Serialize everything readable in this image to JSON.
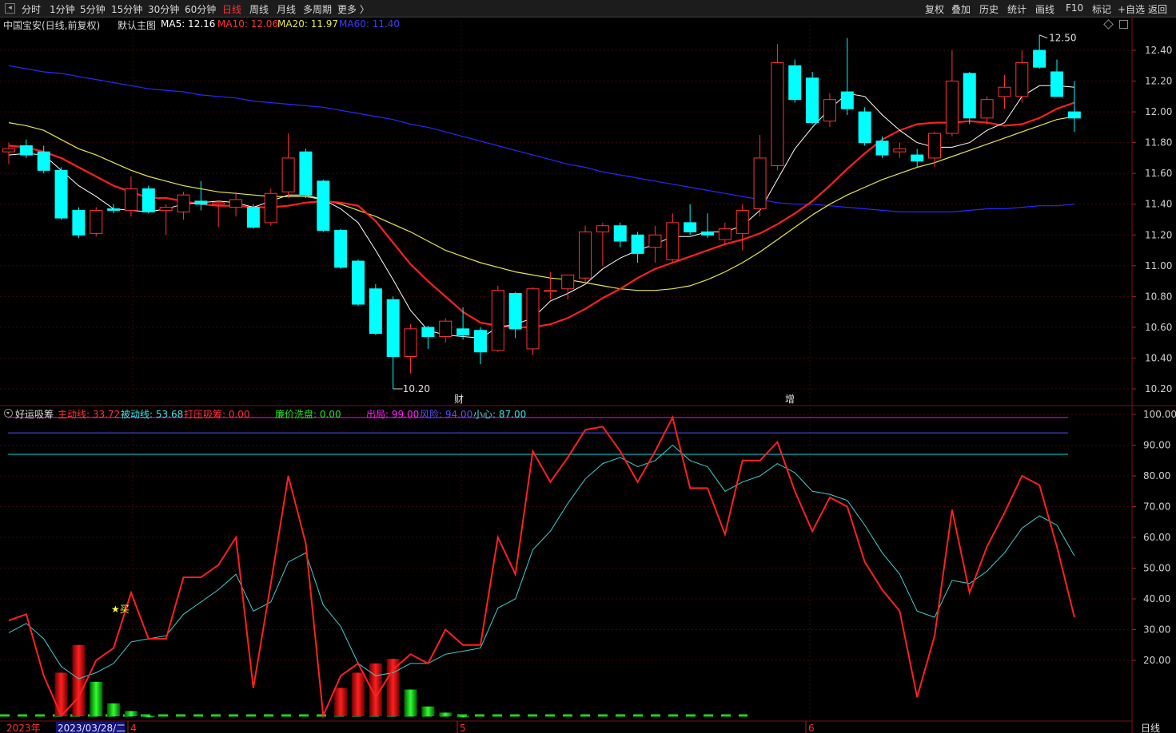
{
  "toolbar": {
    "periods": [
      "分时",
      "1分钟",
      "5分钟",
      "15分钟",
      "30分钟",
      "60分钟",
      "日线",
      "周线",
      "月线",
      "多周期",
      "更多 〉"
    ],
    "active_period": "日线",
    "right": [
      "复权",
      "叠加",
      "历史",
      "统计",
      "画线",
      "F10",
      "标记",
      "+自选",
      "返回"
    ]
  },
  "main_info": {
    "stock": "中国宝安(日线,前复权)",
    "template": "默认主图",
    "ma5": "MA5: 12.16",
    "ma10": "MA10: 12.06",
    "ma20": "MA20: 11.97",
    "ma60": "MA60: 11.40"
  },
  "indicator_info": {
    "name": "好运吸筹",
    "zhudong": "主动线: 33.72",
    "beidong": "被动线: 53.68",
    "dayajixi": "打压吸筹: 0.00",
    "lianjia": "廉价洗盘: 0.00",
    "chuju": "出局: 99.00",
    "fengxian": "风险: 94.00",
    "xiaoxin": "小心: 87.00"
  },
  "colors": {
    "up": "#ff3232",
    "down": "#00ffff",
    "ma5": "#ffffff",
    "ma10": "#ff2020",
    "ma20": "#e6e64a",
    "ma60": "#2828ff",
    "bg": "#000000",
    "chuju": "#ff00ff",
    "fengxian": "#5050ff",
    "xiaoxin": "#00e0e0"
  },
  "chart_data": [
    {
      "type": "candlestick",
      "title": "中国宝安 日线",
      "price_axis_ticks": [
        12.4,
        12.2,
        12.0,
        11.8,
        11.6,
        11.4,
        11.2,
        11.0,
        10.8,
        10.6,
        10.4,
        10.2
      ],
      "ylim": [
        10.12,
        12.52
      ],
      "annotations": {
        "high": "12.50",
        "low": "10.20",
        "event1": "财",
        "event2": "增"
      },
      "candles": [
        {
          "o": 11.74,
          "h": 11.8,
          "l": 11.66,
          "c": 11.76
        },
        {
          "o": 11.78,
          "h": 11.82,
          "l": 11.7,
          "c": 11.72
        },
        {
          "o": 11.74,
          "h": 11.78,
          "l": 11.6,
          "c": 11.62
        },
        {
          "o": 11.62,
          "h": 11.64,
          "l": 11.3,
          "c": 11.31
        },
        {
          "o": 11.36,
          "h": 11.38,
          "l": 11.18,
          "c": 11.2
        },
        {
          "o": 11.21,
          "h": 11.38,
          "l": 11.19,
          "c": 11.36
        },
        {
          "o": 11.37,
          "h": 11.4,
          "l": 11.34,
          "c": 11.36
        },
        {
          "o": 11.36,
          "h": 11.58,
          "l": 11.32,
          "c": 11.5
        },
        {
          "o": 11.5,
          "h": 11.52,
          "l": 11.34,
          "c": 11.35
        },
        {
          "o": 11.36,
          "h": 11.4,
          "l": 11.2,
          "c": 11.38
        },
        {
          "o": 11.35,
          "h": 11.48,
          "l": 11.3,
          "c": 11.46
        },
        {
          "o": 11.42,
          "h": 11.55,
          "l": 11.36,
          "c": 11.4
        },
        {
          "o": 11.4,
          "h": 11.42,
          "l": 11.25,
          "c": 11.41
        },
        {
          "o": 11.38,
          "h": 11.48,
          "l": 11.32,
          "c": 11.43
        },
        {
          "o": 11.38,
          "h": 11.4,
          "l": 11.24,
          "c": 11.25
        },
        {
          "o": 11.28,
          "h": 11.5,
          "l": 11.26,
          "c": 11.47
        },
        {
          "o": 11.48,
          "h": 11.86,
          "l": 11.44,
          "c": 11.7
        },
        {
          "o": 11.74,
          "h": 11.76,
          "l": 11.44,
          "c": 11.46
        },
        {
          "o": 11.55,
          "h": 11.56,
          "l": 11.22,
          "c": 11.23
        },
        {
          "o": 11.23,
          "h": 11.24,
          "l": 10.98,
          "c": 10.99
        },
        {
          "o": 11.03,
          "h": 11.04,
          "l": 10.74,
          "c": 10.75
        },
        {
          "o": 10.85,
          "h": 10.88,
          "l": 10.55,
          "c": 10.56
        },
        {
          "o": 10.78,
          "h": 10.8,
          "l": 10.2,
          "c": 10.41
        },
        {
          "o": 10.41,
          "h": 10.62,
          "l": 10.3,
          "c": 10.59
        },
        {
          "o": 10.6,
          "h": 10.61,
          "l": 10.46,
          "c": 10.54
        },
        {
          "o": 10.54,
          "h": 10.66,
          "l": 10.5,
          "c": 10.64
        },
        {
          "o": 10.59,
          "h": 10.73,
          "l": 10.52,
          "c": 10.55
        },
        {
          "o": 10.58,
          "h": 10.6,
          "l": 10.36,
          "c": 10.44
        },
        {
          "o": 10.45,
          "h": 10.87,
          "l": 10.44,
          "c": 10.84
        },
        {
          "o": 10.82,
          "h": 10.83,
          "l": 10.53,
          "c": 10.59
        },
        {
          "o": 10.46,
          "h": 10.86,
          "l": 10.42,
          "c": 10.85
        },
        {
          "o": 10.84,
          "h": 10.96,
          "l": 10.78,
          "c": 10.84
        },
        {
          "o": 10.85,
          "h": 10.92,
          "l": 10.78,
          "c": 10.94
        },
        {
          "o": 10.92,
          "h": 11.26,
          "l": 10.88,
          "c": 11.22
        },
        {
          "o": 11.22,
          "h": 11.28,
          "l": 11.0,
          "c": 11.26
        },
        {
          "o": 11.26,
          "h": 11.28,
          "l": 11.12,
          "c": 11.16
        },
        {
          "o": 11.2,
          "h": 11.22,
          "l": 11.02,
          "c": 11.08
        },
        {
          "o": 11.12,
          "h": 11.26,
          "l": 11.02,
          "c": 11.2
        },
        {
          "o": 11.04,
          "h": 11.34,
          "l": 11.02,
          "c": 11.28
        },
        {
          "o": 11.28,
          "h": 11.4,
          "l": 11.2,
          "c": 11.22
        },
        {
          "o": 11.22,
          "h": 11.34,
          "l": 11.18,
          "c": 11.2
        },
        {
          "o": 11.17,
          "h": 11.28,
          "l": 11.14,
          "c": 11.24
        },
        {
          "o": 11.21,
          "h": 11.4,
          "l": 11.1,
          "c": 11.36
        },
        {
          "o": 11.37,
          "h": 11.85,
          "l": 11.32,
          "c": 11.7
        },
        {
          "o": 11.65,
          "h": 12.44,
          "l": 11.62,
          "c": 12.32
        },
        {
          "o": 12.3,
          "h": 12.34,
          "l": 12.06,
          "c": 12.08
        },
        {
          "o": 12.22,
          "h": 12.26,
          "l": 11.92,
          "c": 11.93
        },
        {
          "o": 11.94,
          "h": 12.12,
          "l": 11.9,
          "c": 12.08
        },
        {
          "o": 12.13,
          "h": 12.48,
          "l": 11.98,
          "c": 12.02
        },
        {
          "o": 12.0,
          "h": 12.03,
          "l": 11.78,
          "c": 11.8
        },
        {
          "o": 11.81,
          "h": 11.84,
          "l": 11.7,
          "c": 11.72
        },
        {
          "o": 11.74,
          "h": 11.8,
          "l": 11.7,
          "c": 11.76
        },
        {
          "o": 11.72,
          "h": 11.76,
          "l": 11.64,
          "c": 11.68
        },
        {
          "o": 11.7,
          "h": 11.87,
          "l": 11.64,
          "c": 11.86
        },
        {
          "o": 11.86,
          "h": 12.4,
          "l": 11.84,
          "c": 12.2
        },
        {
          "o": 12.25,
          "h": 12.26,
          "l": 11.92,
          "c": 11.96
        },
        {
          "o": 11.96,
          "h": 12.1,
          "l": 11.92,
          "c": 12.08
        },
        {
          "o": 12.1,
          "h": 12.24,
          "l": 12.02,
          "c": 12.16
        },
        {
          "o": 12.1,
          "h": 12.4,
          "l": 12.06,
          "c": 12.32
        },
        {
          "o": 12.4,
          "h": 12.5,
          "l": 12.28,
          "c": 12.29
        },
        {
          "o": 12.26,
          "h": 12.34,
          "l": 12.1,
          "c": 12.1
        },
        {
          "o": 12.0,
          "h": 12.2,
          "l": 11.87,
          "c": 11.96
        }
      ],
      "ma5": [
        11.72,
        11.73,
        11.72,
        11.62,
        11.52,
        11.45,
        11.37,
        11.36,
        11.35,
        11.37,
        11.4,
        11.41,
        11.42,
        11.41,
        11.38,
        11.42,
        11.46,
        11.46,
        11.43,
        11.37,
        11.28,
        11.1,
        10.91,
        10.71,
        10.58,
        10.55,
        10.54,
        10.53,
        10.6,
        10.62,
        10.66,
        10.77,
        10.82,
        10.88,
        10.98,
        11.05,
        11.1,
        11.14,
        11.19,
        11.19,
        11.22,
        11.22,
        11.26,
        11.36,
        11.56,
        11.76,
        11.9,
        12.02,
        12.12,
        12.1,
        11.98,
        11.88,
        11.8,
        11.77,
        11.77,
        11.8,
        11.88,
        11.93,
        12.1,
        12.17,
        12.17,
        12.16
      ],
      "ma10": [
        11.78,
        11.77,
        11.74,
        11.7,
        11.64,
        11.58,
        11.52,
        11.48,
        11.44,
        11.44,
        11.42,
        11.4,
        11.39,
        11.39,
        11.38,
        11.38,
        11.39,
        11.41,
        11.42,
        11.41,
        11.39,
        11.29,
        11.15,
        11.01,
        10.9,
        10.8,
        10.7,
        10.63,
        10.61,
        10.6,
        10.6,
        10.62,
        10.66,
        10.72,
        10.79,
        10.85,
        10.92,
        10.98,
        11.02,
        11.06,
        11.1,
        11.14,
        11.17,
        11.21,
        11.27,
        11.34,
        11.42,
        11.52,
        11.63,
        11.73,
        11.82,
        11.88,
        11.92,
        11.93,
        11.93,
        11.94,
        11.93,
        11.91,
        11.92,
        11.96,
        12.02,
        12.06
      ],
      "ma20": [
        11.93,
        11.91,
        11.88,
        11.82,
        11.76,
        11.72,
        11.67,
        11.62,
        11.58,
        11.55,
        11.52,
        11.5,
        11.48,
        11.47,
        11.46,
        11.45,
        11.45,
        11.45,
        11.43,
        11.4,
        11.36,
        11.32,
        11.27,
        11.22,
        11.16,
        11.1,
        11.06,
        11.02,
        10.99,
        10.96,
        10.94,
        10.92,
        10.91,
        10.89,
        10.87,
        10.85,
        10.84,
        10.84,
        10.85,
        10.87,
        10.91,
        10.96,
        11.02,
        11.09,
        11.17,
        11.25,
        11.33,
        11.4,
        11.46,
        11.51,
        11.56,
        11.6,
        11.64,
        11.67,
        11.71,
        11.75,
        11.79,
        11.83,
        11.87,
        11.91,
        11.95,
        11.97
      ],
      "ma60": [
        12.3,
        12.28,
        12.26,
        12.25,
        12.23,
        12.21,
        12.19,
        12.17,
        12.15,
        12.14,
        12.13,
        12.11,
        12.1,
        12.09,
        12.07,
        12.06,
        12.05,
        12.04,
        12.03,
        12.01,
        11.99,
        11.97,
        11.95,
        11.92,
        11.9,
        11.87,
        11.84,
        11.81,
        11.78,
        11.75,
        11.72,
        11.69,
        11.66,
        11.64,
        11.61,
        11.59,
        11.57,
        11.55,
        11.53,
        11.51,
        11.49,
        11.47,
        11.45,
        11.43,
        11.41,
        11.4,
        11.4,
        11.39,
        11.38,
        11.37,
        11.36,
        11.35,
        11.35,
        11.35,
        11.35,
        11.36,
        11.37,
        11.37,
        11.38,
        11.39,
        11.39,
        11.4
      ]
    },
    {
      "type": "line",
      "title": "好运吸筹",
      "ylim": [
        0,
        102
      ],
      "ticks": [
        100,
        90,
        80,
        70,
        60,
        50,
        40,
        30,
        20
      ],
      "hlines": {
        "chuju": 99,
        "fengxian": 94,
        "xiaoxin": 87
      },
      "annotation": "★买",
      "zhudong": [
        33,
        35,
        15,
        2,
        8,
        20,
        24,
        42,
        27,
        27,
        47,
        47,
        51,
        60,
        11,
        45,
        80,
        58,
        2,
        15,
        19,
        8,
        17,
        22,
        19,
        30,
        25,
        25,
        60,
        48,
        88,
        78,
        86,
        95,
        96,
        88,
        78,
        88,
        99,
        76,
        76,
        61,
        85,
        85,
        91,
        75,
        62,
        73,
        70,
        52,
        43,
        36,
        8,
        28,
        69,
        42,
        57,
        68,
        80,
        77,
        57,
        34
      ],
      "beidong": [
        29,
        32,
        27,
        18,
        14,
        16,
        19,
        26,
        27,
        28,
        35,
        39,
        43,
        48,
        36,
        39,
        52,
        55,
        38,
        31,
        19,
        15,
        16,
        19,
        19,
        22,
        23,
        24,
        37,
        40,
        56,
        62,
        71,
        79,
        84,
        86,
        83,
        85,
        90,
        85,
        83,
        75,
        78,
        80,
        84,
        81,
        75,
        74,
        72,
        64,
        55,
        48,
        36,
        34,
        46,
        45,
        49,
        55,
        63,
        67,
        64,
        54
      ],
      "bars": [
        {
          "t": "r",
          "v": 16
        },
        {
          "t": "r",
          "v": 25
        },
        {
          "t": "g",
          "v": 13
        },
        {
          "t": "g",
          "v": 6
        },
        {
          "t": "g",
          "v": 3.5
        },
        {
          "t": "g",
          "v": 2
        },
        {
          "t": "r",
          "v": 11
        },
        {
          "t": "r",
          "v": 16
        },
        {
          "t": "r",
          "v": 19
        },
        {
          "t": "r",
          "v": 20.5
        },
        {
          "t": "g",
          "v": 10.5
        },
        {
          "t": "g",
          "v": 5
        },
        {
          "t": "g",
          "v": 3
        },
        {
          "t": "g",
          "v": 2
        }
      ]
    }
  ],
  "time_axis": {
    "labels": [
      "2023年",
      "2023/03/28/二",
      "4",
      "5",
      "6"
    ],
    "period_label": "日线"
  }
}
